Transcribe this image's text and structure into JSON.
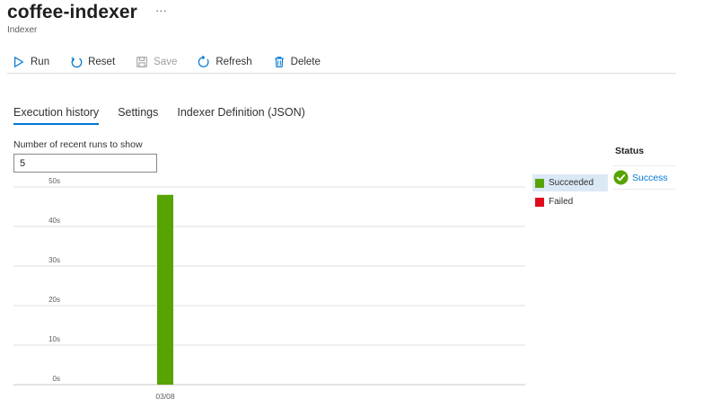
{
  "header": {
    "title": "coffee-indexer",
    "more": "···",
    "subtitle": "Indexer"
  },
  "toolbar": {
    "run_label": "Run",
    "reset_label": "Reset",
    "save_label": "Save",
    "refresh_label": "Refresh",
    "delete_label": "Delete"
  },
  "tabs": [
    {
      "label": "Execution history",
      "active": true
    },
    {
      "label": "Settings",
      "active": false
    },
    {
      "label": "Indexer Definition (JSON)",
      "active": false
    }
  ],
  "runs": {
    "label": "Number of recent runs to show",
    "value": "5"
  },
  "legend": [
    {
      "label": "Succeeded",
      "color": "#57a300",
      "selected": true
    },
    {
      "label": "Failed",
      "color": "#e00b1c",
      "selected": false
    }
  ],
  "status": {
    "header": "Status",
    "value": "Success",
    "icon": "check-circle-icon",
    "color": "#57a300"
  },
  "chart_data": {
    "type": "bar",
    "categories": [
      "03/08"
    ],
    "series": [
      {
        "name": "Succeeded",
        "values": [
          48
        ],
        "color": "#57a300"
      },
      {
        "name": "Failed",
        "values": [
          0
        ],
        "color": "#e00b1c"
      }
    ],
    "y_ticks": [
      "0s",
      "10s",
      "20s",
      "30s",
      "40s",
      "50s"
    ],
    "ylim": [
      0,
      50
    ],
    "grid": true,
    "legend_position": "right"
  }
}
